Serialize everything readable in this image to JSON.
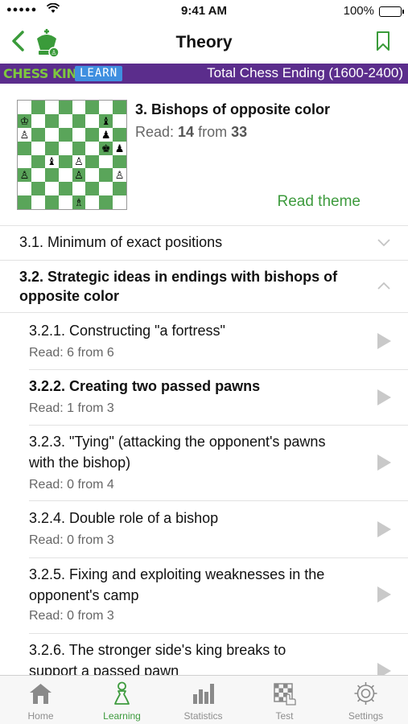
{
  "status_bar": {
    "signal": "●●●●●",
    "time": "9:41 AM",
    "battery": "100%"
  },
  "nav": {
    "title": "Theory",
    "back_glyph": "<"
  },
  "banner": {
    "brand": "CHESS KING",
    "badge": "LEARN",
    "course": "Total Chess Ending (1600-2400)"
  },
  "theme": {
    "title": "3. Bishops of opposite color",
    "read_prefix": "Read: ",
    "read_count": "14",
    "read_mid": " from ",
    "read_total": "33",
    "read_theme_label": "Read theme",
    "board": [
      "........",
      "..........",
      "K.....b.",
      "P.....p.",
      "......kp",
      "..b.P...",
      "P...P..P",
      "........",
      "....B..."
    ]
  },
  "sections": [
    {
      "title": "3.1. Minimum of exact positions",
      "expanded": false
    },
    {
      "title": "3.2. Strategic ideas in endings with bishops of",
      "title2": "opposite color",
      "expanded": true
    }
  ],
  "lessons": [
    {
      "title": "3.2.1. Constructing \"a fortress\"",
      "read": "Read: 6 from 6",
      "bold": false
    },
    {
      "title": "3.2.2. Creating two passed pawns",
      "read": "Read: 1 from 3",
      "bold": true
    },
    {
      "title": "3.2.3. \"Tying\" (attacking the opponent's pawns",
      "title2": "with the bishop)",
      "read": "Read: 0 from 4",
      "bold": false
    },
    {
      "title": "3.2.4. Double role of a bishop",
      "read": "Read: 0 from 3",
      "bold": false
    },
    {
      "title": "3.2.5. Fixing and exploiting weaknesses in the",
      "title2": "opponent's camp",
      "read": "Read: 0 from 3",
      "bold": false
    },
    {
      "title": "3.2.6. The stronger side's king breaks to",
      "title2": "support a passed pawn",
      "bold": false
    }
  ],
  "tabs": [
    {
      "label": "Home",
      "icon": "house-icon"
    },
    {
      "label": "Learning",
      "icon": "pawn-icon",
      "active": true
    },
    {
      "label": "Statistics",
      "icon": "bar-chart-icon"
    },
    {
      "label": "Test",
      "icon": "chessboard-hand-icon"
    },
    {
      "label": "Settings",
      "icon": "gear-icon"
    }
  ],
  "colors": {
    "accent_green": "#3e9b3e",
    "banner_purple": "#5b2d8c",
    "board_dark": "#5aa55a"
  }
}
